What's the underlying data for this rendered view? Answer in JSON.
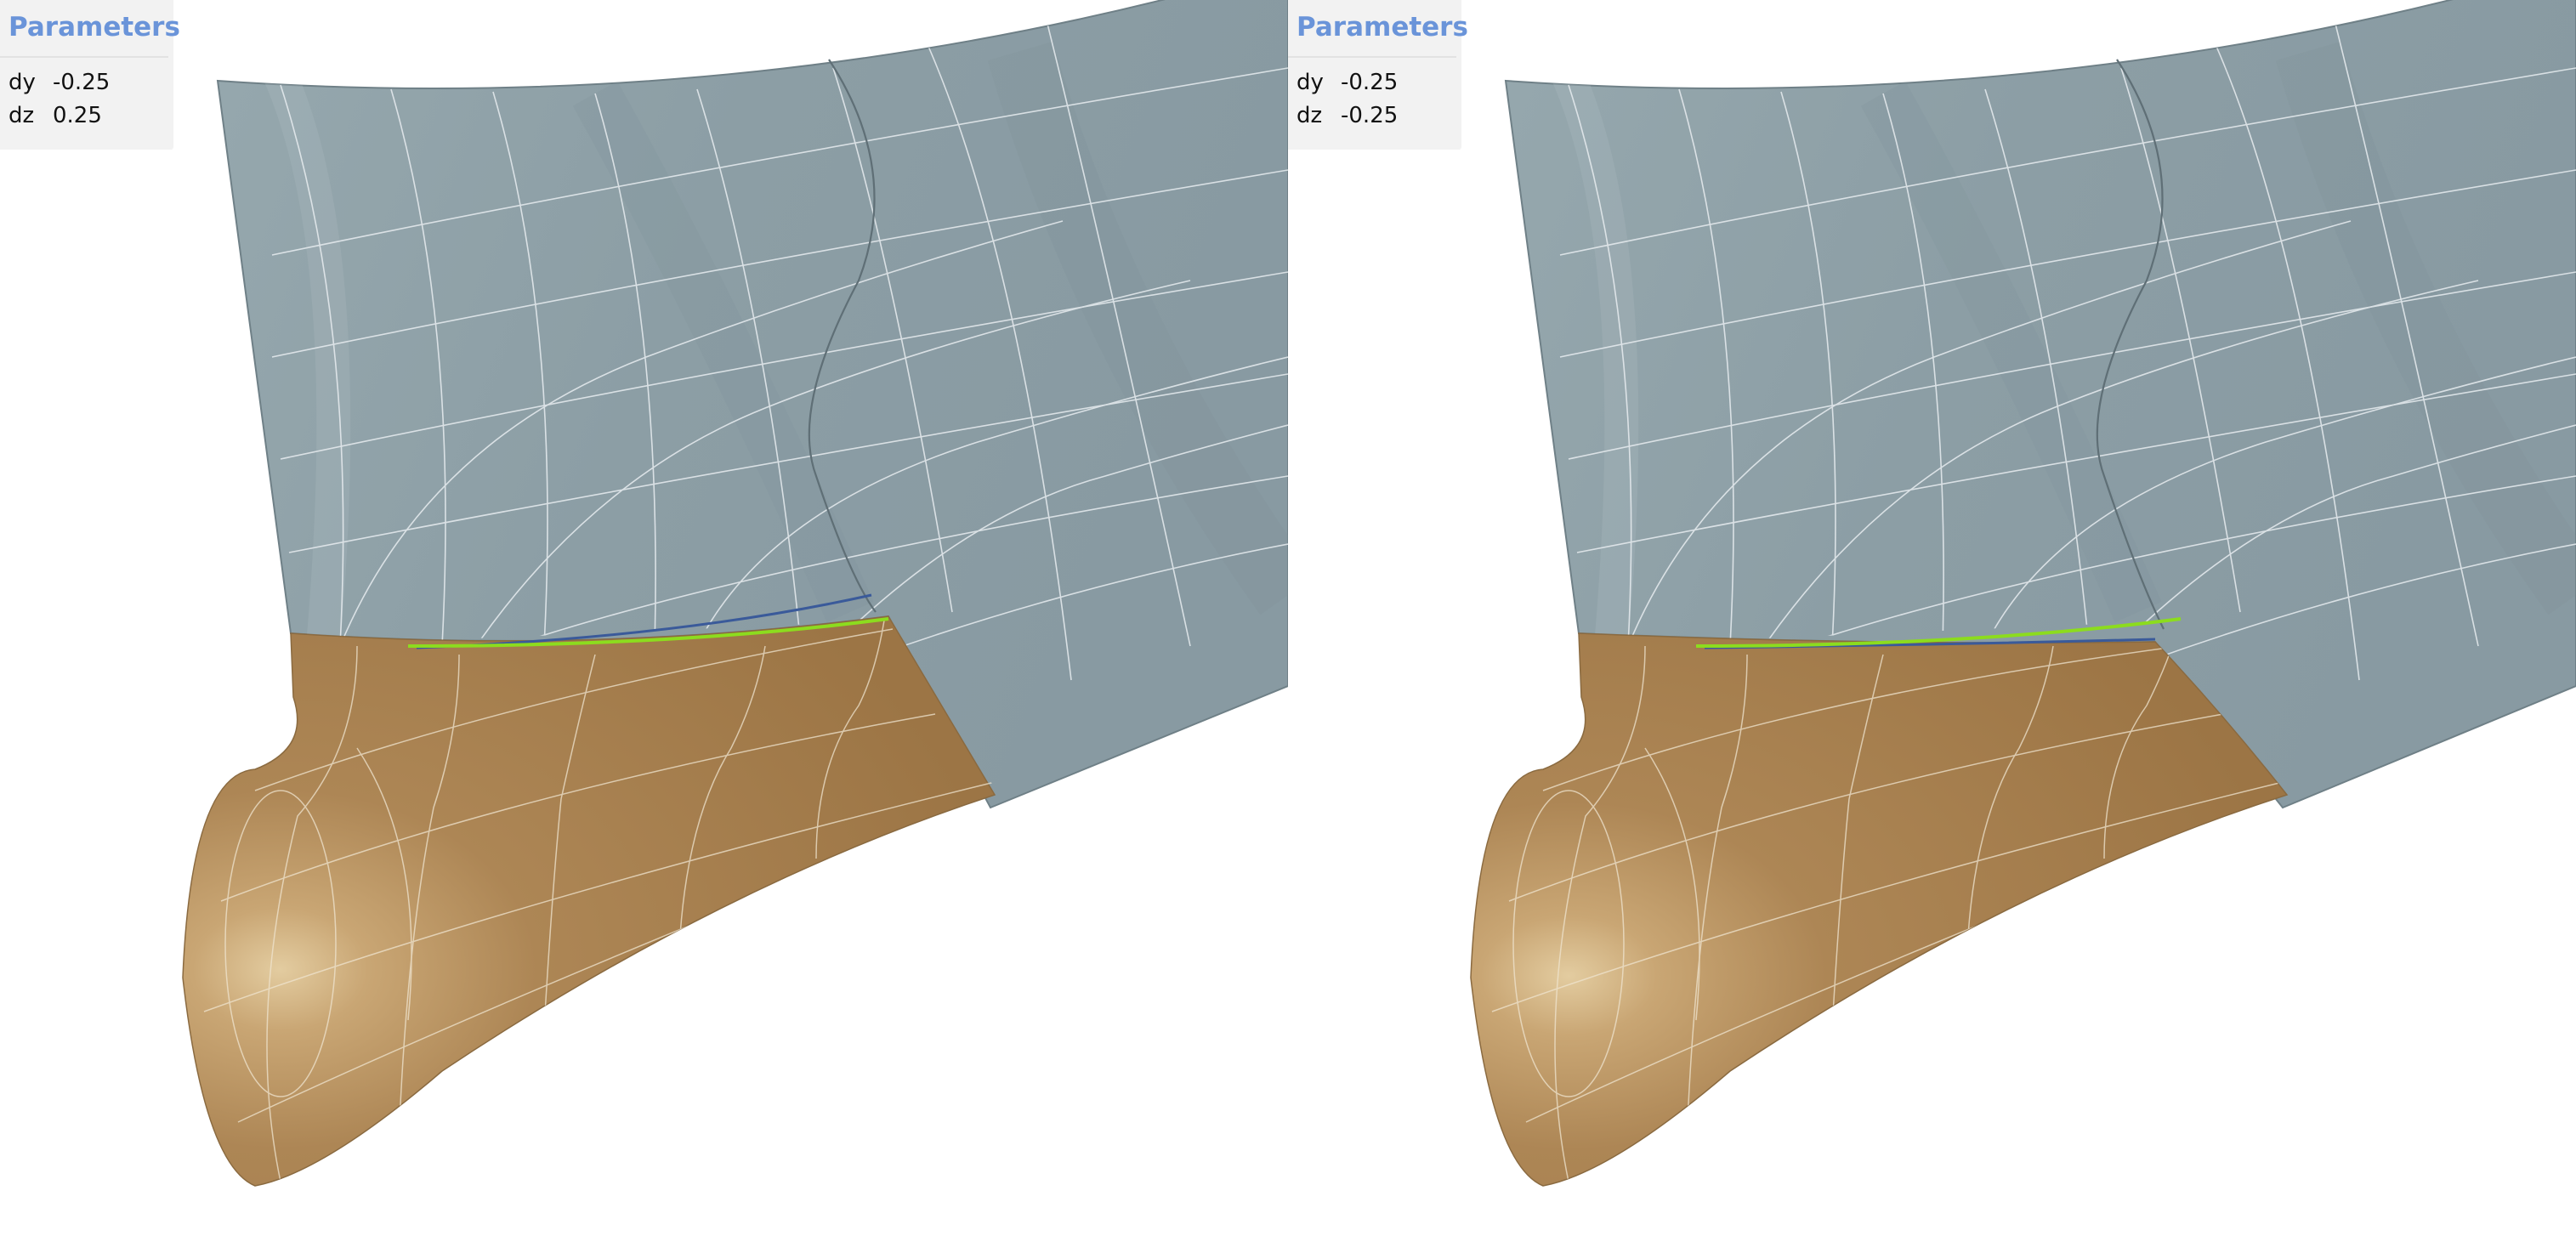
{
  "viewports": [
    {
      "panel_title": "Parameters",
      "params": [
        {
          "name": "dy",
          "value": "-0.25"
        },
        {
          "name": "dz",
          "value": "0.25"
        }
      ]
    },
    {
      "panel_title": "Parameters",
      "params": [
        {
          "name": "dy",
          "value": "-0.25"
        },
        {
          "name": "dz",
          "value": "-0.25"
        }
      ]
    }
  ],
  "colors": {
    "hull": "#8e9fa6",
    "bulb": "#a98453",
    "bulb_highlight": "#e0c79c",
    "intersection_curve": "#8cdc1e",
    "trim_edge": "#3a5a9a",
    "isolines": "#e8edf0",
    "panel_title": "#6a94d9"
  },
  "icons": {
    "scene": "3d-surface-render"
  }
}
